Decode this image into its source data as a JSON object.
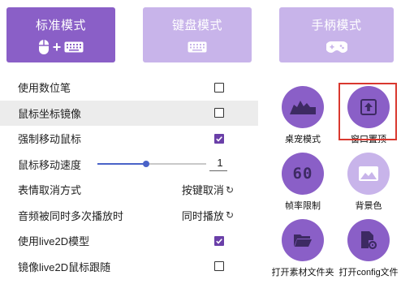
{
  "modes": [
    {
      "label": "标准模式",
      "active": true
    },
    {
      "label": "键盘模式",
      "active": false
    },
    {
      "label": "手柄模式",
      "active": false
    }
  ],
  "settings": {
    "digital_pen": {
      "label": "使用数位笔",
      "checked": false
    },
    "mouse_mirror": {
      "label": "鼠标坐标镜像",
      "checked": false
    },
    "force_move": {
      "label": "强制移动鼠标",
      "checked": true
    },
    "mouse_speed": {
      "label": "鼠标移动速度",
      "value": "1",
      "level": 0.45
    },
    "emote_cancel": {
      "label": "表情取消方式",
      "value": "按键取消"
    },
    "audio_repeat": {
      "label": "音频被同时多次播放时",
      "value": "同时播放"
    },
    "use_live2d": {
      "label": "使用live2D模型",
      "checked": true
    },
    "mirror_live2d": {
      "label": "镜像live2D鼠标跟随",
      "checked": false
    }
  },
  "features": {
    "desk_pet": {
      "label": "桌宠模式"
    },
    "window_top": {
      "label": "窗口置顶"
    },
    "frame_limit": {
      "label": "帧率限制",
      "icon_text": "60"
    },
    "background": {
      "label": "背景色"
    },
    "open_assets": {
      "label": "打开素材文件夹"
    },
    "open_config": {
      "label": "打开config文件"
    }
  },
  "colors": {
    "accent": "#8a5fc7",
    "accent_light": "#c8b4ea",
    "checkbox_checked": "#6a3fa8",
    "slider": "#4a63c8",
    "highlight": "#d9382f"
  }
}
